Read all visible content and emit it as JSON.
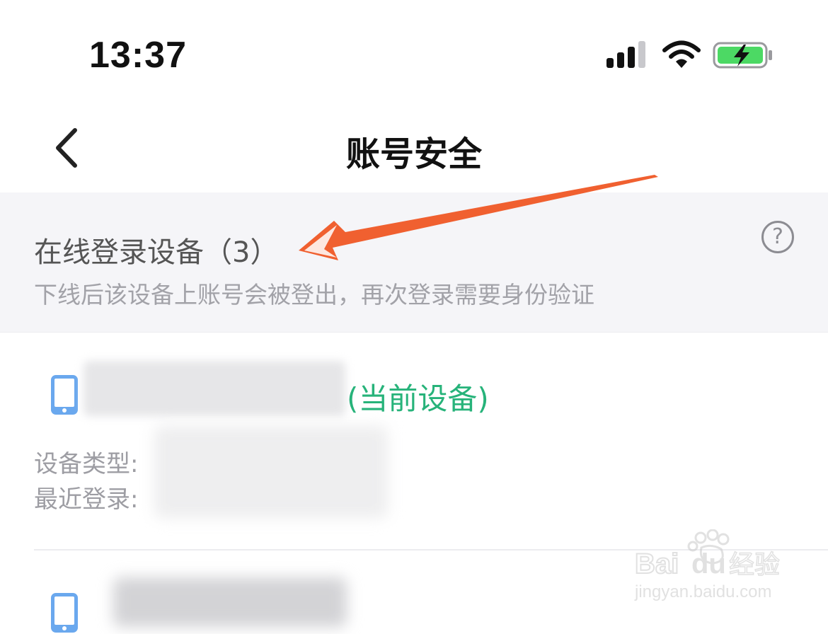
{
  "status_bar": {
    "time": "13:37",
    "icons": [
      "signal-icon",
      "wifi-icon",
      "battery-charging-icon"
    ],
    "battery_color": "#4cd964"
  },
  "nav": {
    "back_icon": "chevron-left-icon",
    "title": "账号安全"
  },
  "online_devices": {
    "heading": "在线登录设备（3）",
    "description": "下线后该设备上账号会被登出，再次登录需要身份验证",
    "help_icon": "question-circle-icon",
    "help_glyph": "?"
  },
  "devices": [
    {
      "icon": "phone-icon",
      "current_tag": "(当前设备)",
      "type_label": "设备类型:",
      "last_login_label": "最近登录:"
    },
    {
      "icon": "phone-icon"
    }
  ],
  "colors": {
    "accent_green": "#27b37a",
    "phone_icon_blue": "#6aa8ee",
    "annotation_arrow": "#f06030",
    "section_bg": "#f5f5f8"
  },
  "watermark": {
    "brand": "Baidu经验",
    "url": "jingyan.baidu.com"
  }
}
